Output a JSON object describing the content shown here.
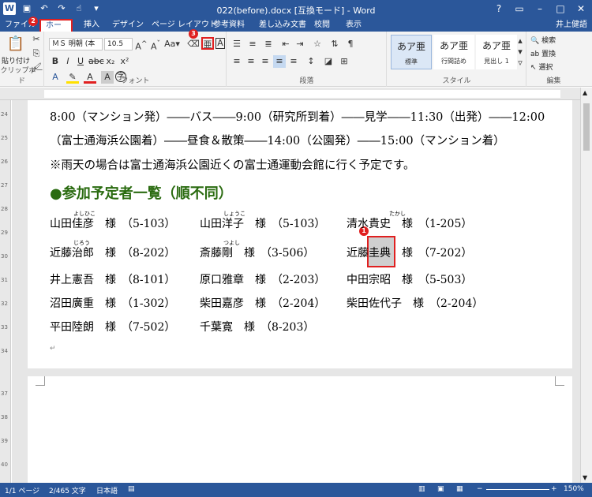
{
  "window": {
    "title": "022(before).docx [互換モード] - Word",
    "user": "井上健語"
  },
  "tabs": [
    "ファイル",
    "ホーム",
    "挿入",
    "デザイン",
    "ページ レイアウト",
    "参考資料",
    "差し込み文書",
    "校閲",
    "表示"
  ],
  "ribbon": {
    "clipboard": {
      "paste": "貼り付け",
      "label": "クリップボード"
    },
    "font": {
      "name": "ＭＳ 明朝 (本",
      "size": "10.5",
      "label": "フォント"
    },
    "paragraph": {
      "label": "段落"
    },
    "styles": {
      "label": "スタイル",
      "items": [
        {
          "preview": "あア亜",
          "name": "標準"
        },
        {
          "preview": "あア亜",
          "name": "行間詰め"
        },
        {
          "preview": "あア亜",
          "name": "見出し 1"
        }
      ]
    },
    "editing": {
      "search": "検索",
      "replace": "置換",
      "select": "選択",
      "label": "編集"
    }
  },
  "callouts": [
    "1",
    "2",
    "3"
  ],
  "doc": {
    "lines": [
      "8:00（マンション発）――バス――9:00（研究所到着）――見学――11:30（出発）――12:00",
      "（富士通海浜公園着）――昼食＆散策――14:00（公園発）――15:00（マンション着）",
      "※雨天の場合は富士通海浜公園近くの富士通運動会館に行く予定です。"
    ],
    "heading": "●参加予定者一覧（順不同）",
    "attendees": [
      [
        "山田佳彦　様　（5-103）",
        "山田洋子　様　（5-103）",
        "清水貴史　様　（1-205）"
      ],
      [
        "近藤治郎　様　（8-202）",
        "斎藤剛　様　（3-506）",
        "近藤圭典　様　（7-202）"
      ],
      [
        "井上憲吾　様　（8-101）",
        "原口雅章　様　（2-203）",
        "中田宗昭　様　（5-503）"
      ],
      [
        "沼田廣重　様　（1-302）",
        "柴田嘉彦　様　（2-204）",
        "柴田佐代子　様　（2-204）"
      ],
      [
        "平田陸朗　様　（7-502）",
        "千葉寛　様　（8-203）"
      ]
    ],
    "ruby": [
      "よしひこ",
      "しょうこ",
      "たかし",
      "じろう",
      "つよし"
    ]
  },
  "status": {
    "page": "1/1 ページ",
    "words": "2/465 文字",
    "lang": "日本語",
    "zoom": "150%"
  }
}
